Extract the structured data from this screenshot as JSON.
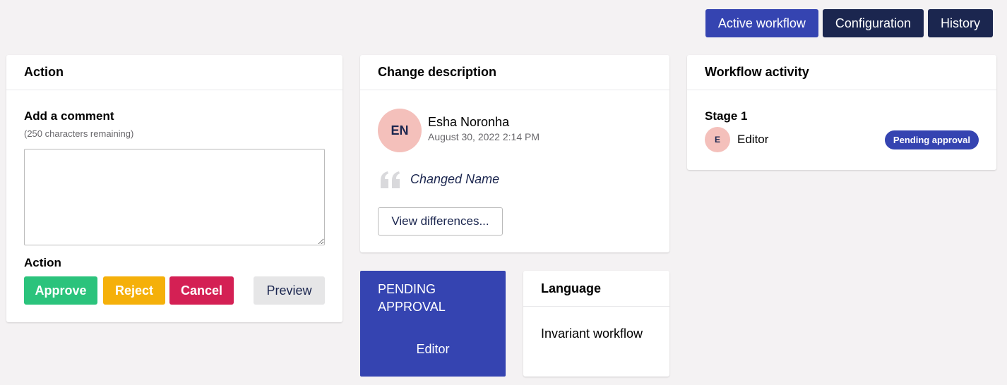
{
  "header_tabs": [
    {
      "label": "Active workflow",
      "active": true
    },
    {
      "label": "Configuration",
      "active": false
    },
    {
      "label": "History",
      "active": false
    }
  ],
  "action_card": {
    "title": "Action",
    "comment_label": "Add a comment",
    "chars_remaining": "(250 characters remaining)",
    "comment_value": "",
    "action_label": "Action",
    "buttons": {
      "approve": "Approve",
      "reject": "Reject",
      "cancel": "Cancel",
      "preview": "Preview"
    }
  },
  "change_card": {
    "title": "Change description",
    "avatar_initials": "EN",
    "author": "Esha Noronha",
    "date": "August 30, 2022 2:14 PM",
    "description": "Changed Name",
    "diff_button": "View differences..."
  },
  "activity_card": {
    "title": "Workflow activity",
    "stage": "Stage 1",
    "avatar_initial": "E",
    "user": "Editor",
    "status": "Pending approval"
  },
  "pending_box": {
    "status": "PENDING APPROVAL",
    "role": "Editor"
  },
  "language_card": {
    "title": "Language",
    "value": "Invariant workflow"
  },
  "colors": {
    "primary": "#3544b1",
    "dark": "#1b264f",
    "approve": "#2bc37c",
    "reject": "#f5b00a",
    "cancel": "#d42054",
    "avatar": "#f4c0bb",
    "background": "#f4f2f3"
  },
  "icons": {
    "quote": "quote-icon",
    "resize": "resize-handle"
  }
}
